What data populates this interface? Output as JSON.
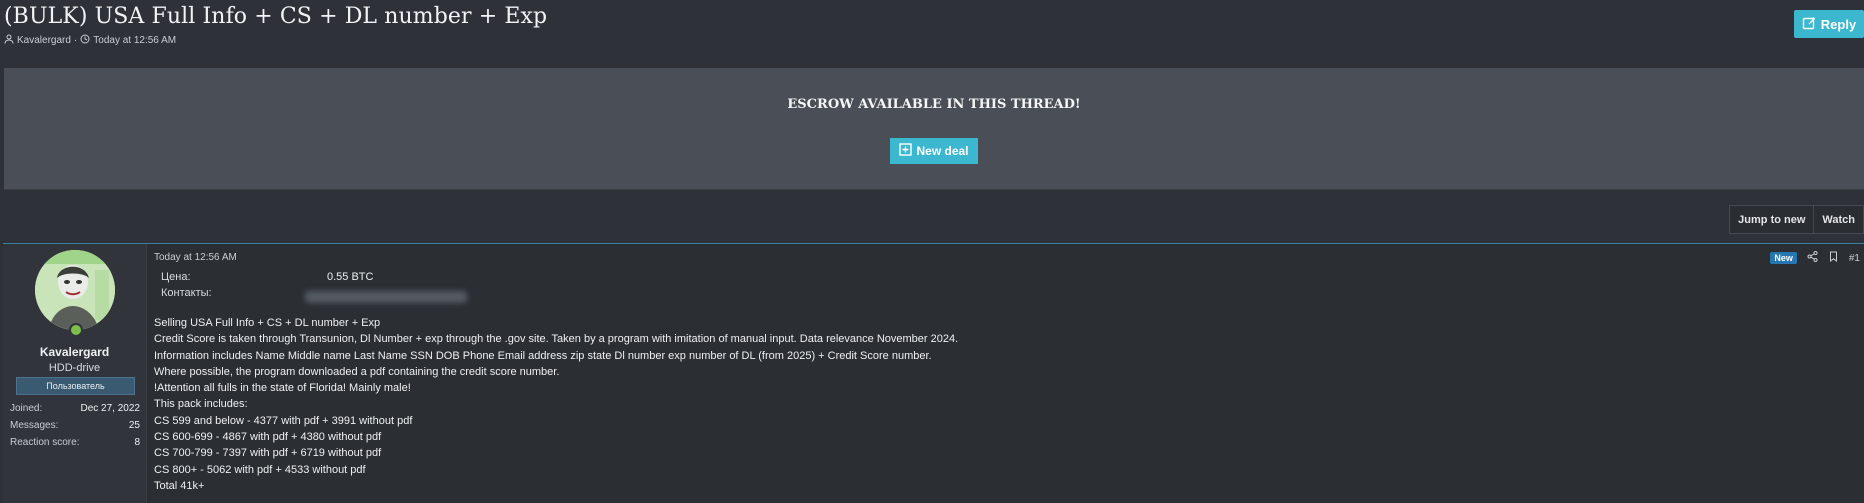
{
  "thread": {
    "title": "(BULK) USA Full Info + CS + DL number + Exp",
    "author": "Kavalergard",
    "separator": "·",
    "date": "Today at 12:56 AM",
    "reply_label": "Reply"
  },
  "escrow": {
    "title": "ESCROW AVAILABLE IN THIS THREAD!",
    "new_deal_label": "New deal"
  },
  "thread_actions": {
    "jump_label": "Jump to new",
    "watch_label": "Watch"
  },
  "post": {
    "date": "Today at 12:56 AM",
    "new_badge": "New",
    "number": "#1",
    "fields": [
      {
        "label": "Цена:",
        "value": "0.55 BTC"
      },
      {
        "label": "Контакты:",
        "value": ""
      }
    ],
    "body_lines": [
      "Selling USA Full Info + CS + DL number + Exp",
      "Credit Score is taken through Transunion, Dl Number + exp through the .gov site. Taken by a program with imitation of manual input. Data relevance November 2024.",
      "Information includes Name Middle name Last Name SSN DOB Phone Email address zip state Dl number exp number of DL (from 2025) + Credit Score number.",
      "Where possible, the program downloaded a pdf containing the credit score number.",
      "!Attention all fulls in the state of Florida! Mainly male!",
      "This pack includes:",
      "CS 599 and below - 4377 with pdf + 3991 without pdf",
      "CS 600-699 - 4867 with pdf + 4380 without pdf",
      "CS 700-799 - 7397 with pdf + 6719 without pdf",
      "CS 800+ - 5062 with pdf + 4533 without pdf",
      "Total 41k+"
    ]
  },
  "user": {
    "name": "Kavalergard",
    "title": "HDD-drive",
    "banner": "Пользователь",
    "stats": [
      {
        "label": "Joined:",
        "value": "Dec 27, 2022"
      },
      {
        "label": "Messages:",
        "value": "25"
      },
      {
        "label": "Reaction score:",
        "value": "8"
      }
    ]
  },
  "colors": {
    "accent": "#3bb8d0",
    "background": "#2e3238",
    "panel": "#4a4f57"
  },
  "icons": [
    "user-icon",
    "clock-icon",
    "edit-icon",
    "plus-square-icon",
    "share-icon",
    "bookmark-icon"
  ]
}
